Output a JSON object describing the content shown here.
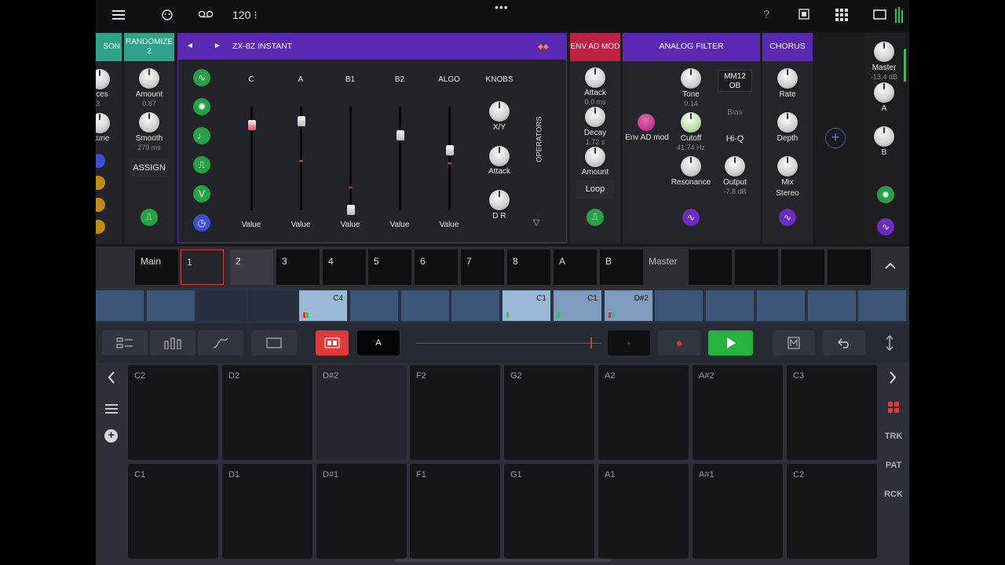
{
  "topbar": {
    "tempo": "120 ⁝",
    "menu_icon": "hamburger-icon",
    "help_label": "?"
  },
  "modules": {
    "left_partial": {
      "header": "SON",
      "labels": [
        "ices",
        "3",
        "tune"
      ]
    },
    "randomize": {
      "header_line1": "RANDOMIZE",
      "header_line2": "2",
      "amount_label": "Amount",
      "amount_value": "0.87",
      "smooth_label": "Smooth",
      "smooth_value": "279 ms",
      "assign_label": "ASSIGN"
    },
    "synth": {
      "prev_label": "◄",
      "next_label": "►",
      "title": "ZX-8Z INSTANT",
      "right_icon": "◆◆",
      "columns": [
        "C",
        "A",
        "B1",
        "B2",
        "ALGO",
        "KNOBS"
      ],
      "value_label": "Value",
      "xy_label": "X/Y",
      "attack_label": "Attack",
      "dr_label": "D R",
      "operators_label": "OPERATORS",
      "down_arrow": "▽"
    },
    "env": {
      "header": "ENV AD MOD",
      "attack_label": "Attack",
      "attack_value": "0.0 ms",
      "decay_label": "Decay",
      "decay_value": "1.72 s",
      "amount_label": "Amount",
      "loop_label": "Loop"
    },
    "filter": {
      "header": "ANALOG FILTER",
      "envmod_label": "Env AD mod",
      "tone_label": "Tone",
      "tone_value": "0.14",
      "mode_line1": "MM12",
      "mode_line2": "OB",
      "bias_label": "Bias",
      "cutoff_label": "Cutoff",
      "cutoff_value": "41.74 Hz",
      "hiq_label": "Hi-Q",
      "resonance_label": "Resonance",
      "output_label": "Output",
      "output_value": "-7.8 dB"
    },
    "chorus": {
      "header": "CHORUS",
      "rate_label": "Rate",
      "depth_label": "Depth",
      "mix_label": "Mix",
      "stereo_label": "Stereo"
    },
    "master": {
      "master_label": "Master",
      "master_value": "-13.4 dB",
      "a_label": "A",
      "b_label": "B"
    }
  },
  "tracks": [
    "Main",
    "1",
    "2",
    "3",
    "4",
    "5",
    "6",
    "7",
    "8",
    "A",
    "B",
    "Master"
  ],
  "patterns": [
    "",
    "",
    "",
    "",
    "C4",
    "",
    "",
    "",
    "C1",
    "C1",
    "D#2",
    "",
    "",
    "",
    "",
    ""
  ],
  "controls": {
    "scene_label": "A"
  },
  "pads_top": [
    "C2",
    "D2",
    "D#2",
    "F2",
    "G2",
    "A2",
    "A#2",
    "C3"
  ],
  "pads_bottom": [
    "C1",
    "D1",
    "D#1",
    "F1",
    "G1",
    "A1",
    "A#1",
    "C2"
  ],
  "right_side": {
    "trk": "TRK",
    "pat": "PAT",
    "rck": "RCK"
  },
  "colors": {
    "accent_purple": "#5a2ab3",
    "accent_green": "#27a046",
    "teal": "#2fa38a",
    "env_red": "#bb2244",
    "record": "#e03030",
    "play": "#27b33f"
  }
}
